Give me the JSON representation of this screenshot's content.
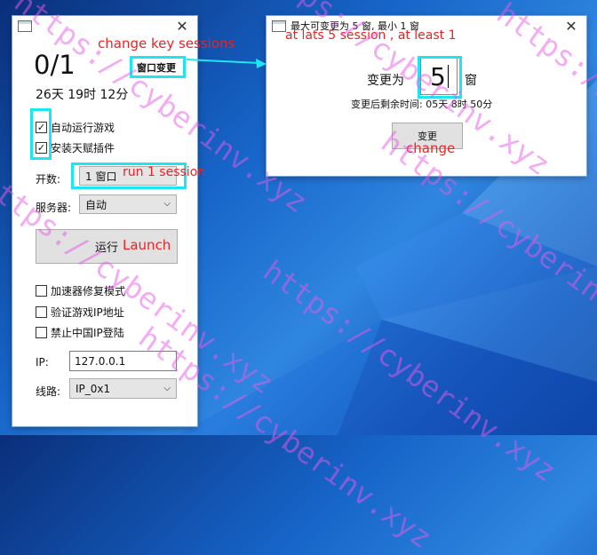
{
  "main_window": {
    "counter": "0/1",
    "change_button": "窗口变更",
    "time_remaining": "26天 19时 12分",
    "checkboxes": [
      {
        "label": "自动运行游戏",
        "checked": true
      },
      {
        "label": "安装天赋插件",
        "checked": true
      }
    ],
    "session_label": "开数:",
    "session_value": "1 窗口",
    "server_label": "服务器:",
    "server_value": "自动",
    "run_button": "运行",
    "options": [
      {
        "label": "加速器修复模式",
        "checked": false
      },
      {
        "label": "验证游戏IP地址",
        "checked": false
      },
      {
        "label": "禁止中国IP登陆",
        "checked": false
      }
    ],
    "ip_label": "IP:",
    "ip_value": "127.0.0.1",
    "line_label": "线路:",
    "line_value": "IP_0x1"
  },
  "dialog": {
    "title": "最大可变更为 5 窗, 最小 1 窗",
    "change_to_label": "变更为",
    "change_to_value": "5",
    "unit": "窗",
    "remaining": "变更后剩余时间: 05天 8时 50分",
    "change_button": "变更"
  },
  "annotations": {
    "change_key_sessions": "change key sessions",
    "at_least": "at lats 5 session , at least 1",
    "run_1_session": "run 1 session",
    "launch": "Launch",
    "change": "change"
  },
  "watermark_text": "https://cyberinv.xyz",
  "colors": {
    "highlight": "#1ee6f0",
    "annotation": "#ee2222",
    "watermark": "#e85ae8",
    "desktop": "#1664c8"
  }
}
